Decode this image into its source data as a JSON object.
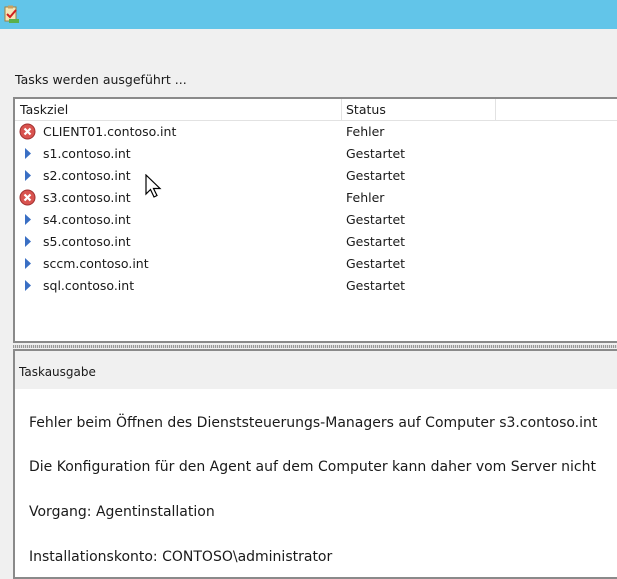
{
  "window": {
    "icon": "task-clipboard-icon"
  },
  "heading": "Tasks werden ausgeführt ...",
  "list": {
    "columns": [
      "Taskziel",
      "Status"
    ],
    "rows": [
      {
        "target": "CLIENT01.contoso.int",
        "status": "Fehler",
        "icon": "error-icon"
      },
      {
        "target": "s1.contoso.int",
        "status": "Gestartet",
        "icon": "play-arrow-icon"
      },
      {
        "target": "s2.contoso.int",
        "status": "Gestartet",
        "icon": "play-arrow-icon"
      },
      {
        "target": "s3.contoso.int",
        "status": "Fehler",
        "icon": "error-icon"
      },
      {
        "target": "s4.contoso.int",
        "status": "Gestartet",
        "icon": "play-arrow-icon"
      },
      {
        "target": "s5.contoso.int",
        "status": "Gestartet",
        "icon": "play-arrow-icon"
      },
      {
        "target": "sccm.contoso.int",
        "status": "Gestartet",
        "icon": "play-arrow-icon"
      },
      {
        "target": "sql.contoso.int",
        "status": "Gestartet",
        "icon": "play-arrow-icon"
      }
    ]
  },
  "output": {
    "title": "Taskausgabe",
    "lines": [
      "Fehler beim Öffnen des Dienststeuerungs-Managers auf Computer s3.contoso.int",
      "Die Konfiguration für den Agent auf dem Computer kann daher vom Server nicht",
      "Vorgang: Agentinstallation",
      "Installationskonto: CONTOSO\\administrator"
    ]
  },
  "colors": {
    "titlebar": "#62c5e9",
    "error": "#d9534f",
    "arrow": "#3a6fc4"
  }
}
